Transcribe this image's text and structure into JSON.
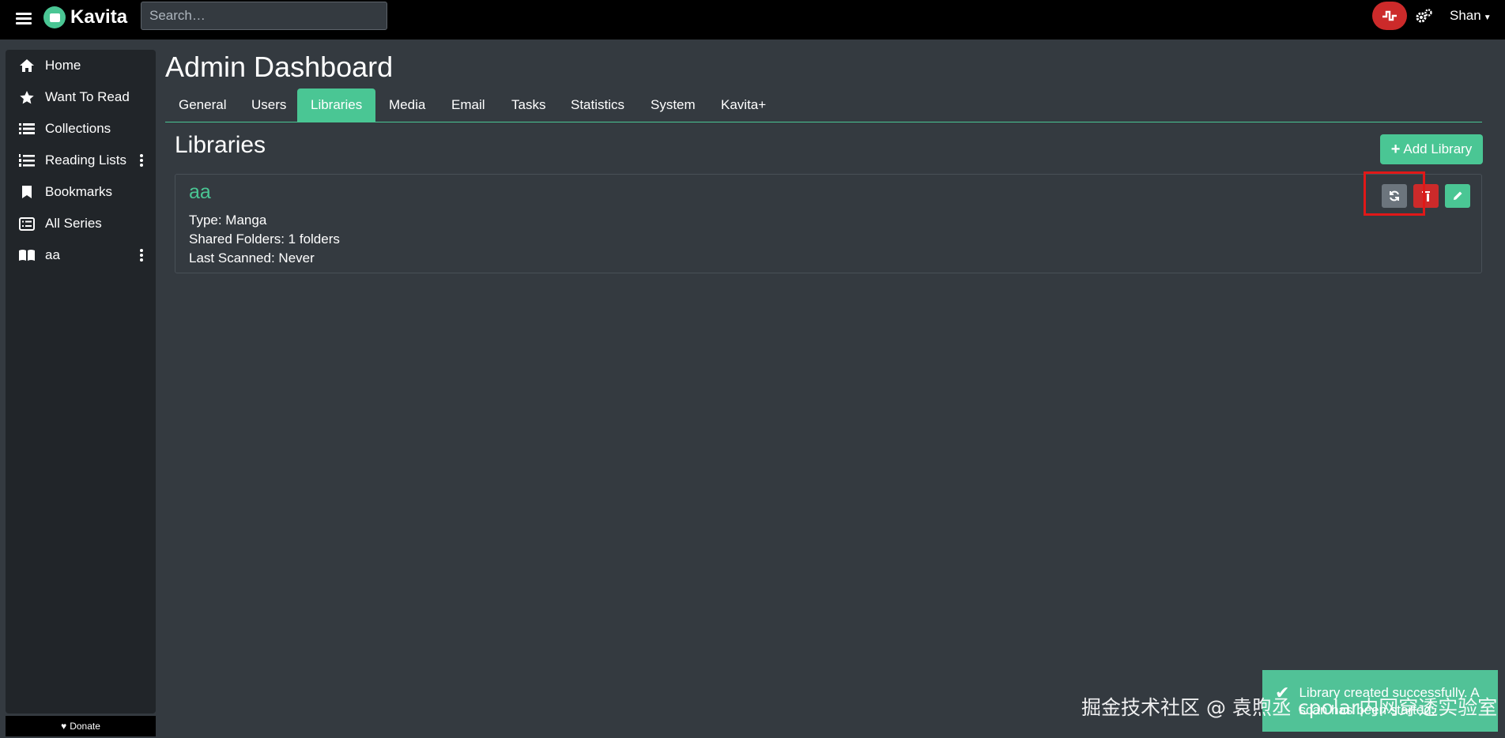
{
  "app": {
    "name": "Kavita",
    "brand_color": "#4ac694"
  },
  "topbar": {
    "search_placeholder": "Search…",
    "user_name": "Shan",
    "activity_icon": "activity-pulse-icon",
    "settings_icon": "gears-icon"
  },
  "sidebar": {
    "items": [
      {
        "label": "Home",
        "icon": "home-icon"
      },
      {
        "label": "Want To Read",
        "icon": "star-icon"
      },
      {
        "label": "Collections",
        "icon": "list-icon"
      },
      {
        "label": "Reading Lists",
        "icon": "list-ol-icon"
      },
      {
        "label": "Bookmarks",
        "icon": "bookmark-icon"
      },
      {
        "label": "All Series",
        "icon": "list-alt-icon"
      },
      {
        "label": "aa",
        "icon": "book-open-icon"
      }
    ],
    "donate_label": "Donate"
  },
  "main": {
    "title": "Admin Dashboard",
    "tabs": [
      {
        "label": "General"
      },
      {
        "label": "Users"
      },
      {
        "label": "Libraries",
        "active": true
      },
      {
        "label": "Media"
      },
      {
        "label": "Email"
      },
      {
        "label": "Tasks"
      },
      {
        "label": "Statistics"
      },
      {
        "label": "System"
      },
      {
        "label": "Kavita+"
      }
    ],
    "section_title": "Libraries",
    "add_library_label": "Add Library",
    "libraries": [
      {
        "name": "aa",
        "type": "Type: Manga",
        "shared_folders": "Shared Folders: 1 folders",
        "last_scanned": "Last Scanned: Never"
      }
    ]
  },
  "toast": {
    "line1": "Library created successfully. A",
    "line2": "scan has been started."
  },
  "watermark": "掘金技术社区 @ 袁煦丞 cpolar内网穿透实验室"
}
